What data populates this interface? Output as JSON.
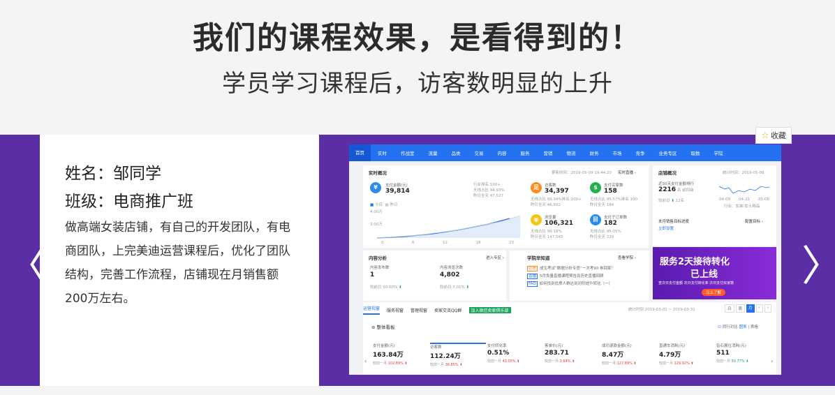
{
  "hero": {
    "title": "我们的课程效果，是看得到的！",
    "subtitle": "学员学习课程后，访客数明显的上升"
  },
  "student": {
    "name_line": "姓名：邹同学",
    "class_line": "班级：电商推广班",
    "description": "做高端女装店铺，有自己的开发团队，有电商团队，上完美迪运营课程后，优化了团队结构，完善工作流程，店铺现在月销售额200万左右。"
  },
  "favorite": {
    "star": "☆",
    "label": "收藏"
  },
  "carousel": {
    "prev": "〈",
    "next": "〉"
  },
  "colors": {
    "band": "#5b2ea6",
    "nav": "#2472f0"
  },
  "screenshot": {
    "nav": [
      "首页",
      "实时",
      "作战室",
      "流量",
      "品类",
      "交易",
      "内容",
      "服务",
      "营销",
      "物流",
      "财务",
      "市场",
      "竞争",
      "业务专区",
      "取数",
      "学院"
    ],
    "realtime": {
      "title": "实时概况",
      "updated": "更新时间：2019-05-09 19:44:20",
      "link": "实时直播 ›",
      "pay_label": "支付金额(元)",
      "pay_value": "39,814",
      "rank_lines": [
        "行业排名 100+",
        "无线占比 94.93%",
        "昨日全天 47,527"
      ],
      "legend_today": "今日",
      "legend_yesterday": "昨日",
      "y_ticks": [
        "4.00万",
        "3.00万"
      ],
      "x_ticks": [
        "0",
        "6",
        "12",
        "18",
        "23"
      ],
      "metrics": [
        {
          "icon": "足",
          "color": "#ff8a1f",
          "label": "访客数",
          "value": "34,397",
          "l1": "无线占比 99.34%排名 100+",
          "l2": "昨日全天 46,652"
        },
        {
          "icon": "$",
          "color": "#22b14c",
          "label": "支付买家数",
          "value": "158",
          "l1": "无线占比 95.57%排名 100",
          "l2": "昨日全天 184"
        },
        {
          "icon": "◉",
          "color": "#f5c518",
          "label": "浏览量",
          "value": "106,321",
          "l1": "无线占比 99.18%",
          "l2": "昨日全天 147,545"
        },
        {
          "icon": "目",
          "color": "#2b8cf0",
          "label": "支付子订单数",
          "value": "182",
          "l1": "无线占比 95.05%",
          "l2": "昨日全天 229"
        }
      ]
    },
    "shop": {
      "title": "店铺概况",
      "stats_time": "统计时间：2019-05-08",
      "rank_title": "近30天支付金额排行",
      "rank_value": "2216",
      "rank_unit": "名 前四级",
      "prev_label": "较前日",
      "prev_value": "12名",
      "spark_dates": [
        "04-09",
        "04-21",
        "05-08"
      ],
      "industry": "行业：女装/女士精品",
      "month_goal": "本月销售目标进度",
      "goal_link": "配置目标 ›",
      "setup_link": "立即设置"
    },
    "content": {
      "title": "内容分析",
      "link": "进入专区 ›",
      "a_label": "内容发布数",
      "a_value": "1",
      "a_cmp": "较前日",
      "a_pct": "50.00%",
      "b_label": "内容浏览次数",
      "b_value": "4,802",
      "b_cmp": "较前日",
      "b_pct": "7.01%"
    },
    "learn": {
      "title": "学院早知道",
      "link": "查看学院 ›",
      "items": [
        {
          "tag": "必看",
          "text": "成生考试“数据分析专员”一次考90 券回家！"
        },
        {
          "tag": "直播",
          "text": "5月免量直播课程预告及历史直播回顾"
        },
        {
          "tag": "FAQ",
          "text": "如何找到优质人群达到对阶提升转化（一）"
        }
      ]
    },
    "banner": {
      "line1": "服务2天接待转化",
      "line2": "已上线",
      "sub": "查次日支付金额  次日支付转化率  次日支付买家数",
      "button": "马上了解"
    },
    "tabs": [
      "运营视窗",
      "服务视窗",
      "管理视窗",
      "卖家交流QQ群",
      "加入微信卖家俱乐部"
    ],
    "range": "统计时间 2019-03-01 ~ 2019-03-31",
    "period": [
      "日",
      "周",
      "月"
    ],
    "overview_title": "整体看板",
    "compare": "同行对比",
    "view": [
      "图表",
      "表格"
    ],
    "kpis": [
      {
        "label": "支付金额(元)",
        "value": "163.84万",
        "cmp": "较前一月",
        "pct": "102.89%",
        "dir": "up"
      },
      {
        "label": "访客数",
        "value": "112.24万",
        "cmp": "较前一月",
        "pct": "36.85%",
        "dir": "up"
      },
      {
        "label": "支付转化率",
        "value": "0.51%",
        "cmp": "较前一月",
        "pct": "43.05%",
        "dir": "up"
      },
      {
        "label": "客单价(元)",
        "value": "283.71",
        "cmp": "较前一月",
        "pct": "3.64%",
        "dir": "up"
      },
      {
        "label": "成功退款金额(元)",
        "value": "8.47万",
        "cmp": "较前一月",
        "pct": "127.89%",
        "dir": "up"
      },
      {
        "label": "直通车消耗(元)",
        "value": "4.79万",
        "cmp": "较前一月",
        "pct": "129.92%",
        "dir": "up"
      },
      {
        "label": "钻石展位消耗(元)",
        "value": "511",
        "cmp": "较前一月",
        "pct": "50.77%",
        "dir": "down"
      }
    ]
  }
}
